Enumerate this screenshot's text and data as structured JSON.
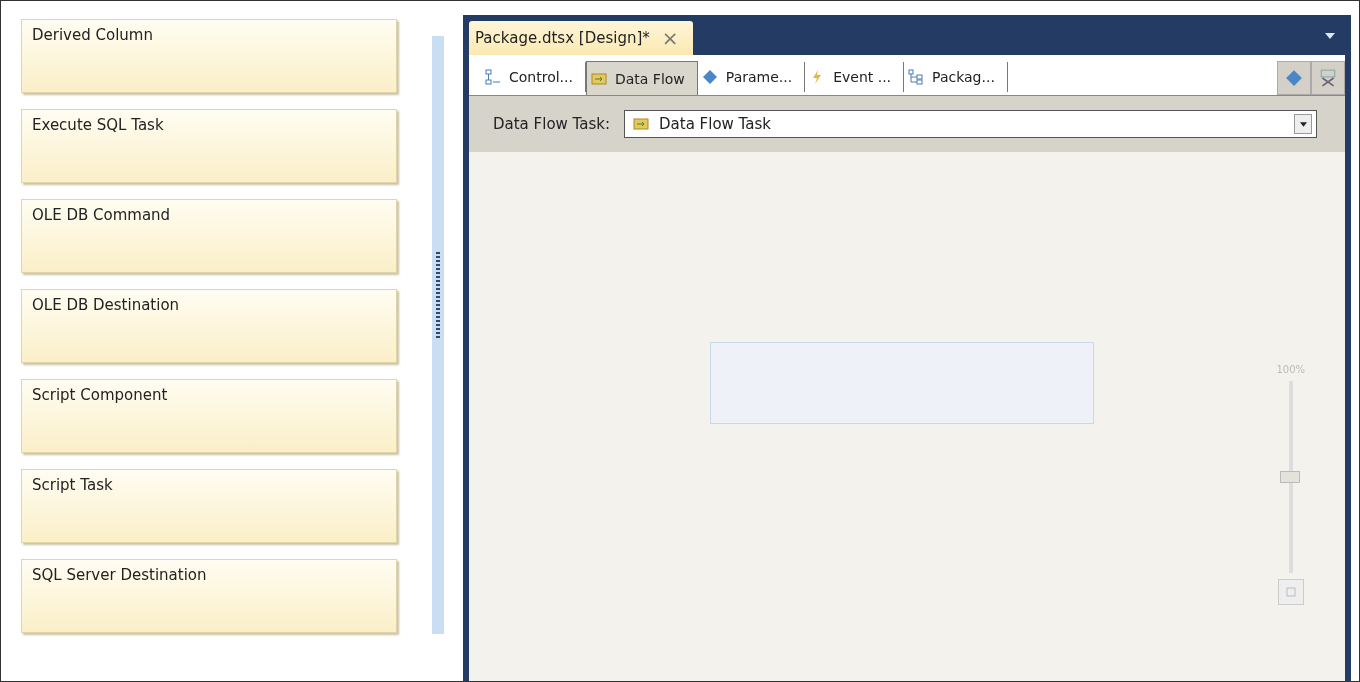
{
  "toolbox": {
    "items": [
      {
        "label": "Derived Column"
      },
      {
        "label": "Execute SQL Task"
      },
      {
        "label": "OLE DB Command"
      },
      {
        "label": "OLE DB Destination"
      },
      {
        "label": "Script Component"
      },
      {
        "label": "Script Task"
      },
      {
        "label": "SQL Server Destination"
      }
    ]
  },
  "document_tab": {
    "title": "Package.dtsx [Design]*",
    "close": "×"
  },
  "designer_tabs": [
    {
      "kind": "control",
      "label": "Control...",
      "selected": false
    },
    {
      "kind": "dataflow",
      "label": "Data Flow",
      "selected": true
    },
    {
      "kind": "param",
      "label": "Parame...",
      "selected": false
    },
    {
      "kind": "event",
      "label": "Event ...",
      "selected": false
    },
    {
      "kind": "package",
      "label": "Packag...",
      "selected": false
    }
  ],
  "task_bar": {
    "label": "Data Flow Task:",
    "value": "Data Flow Task"
  },
  "zoom": {
    "reading": "100%",
    "level": 0.5
  }
}
